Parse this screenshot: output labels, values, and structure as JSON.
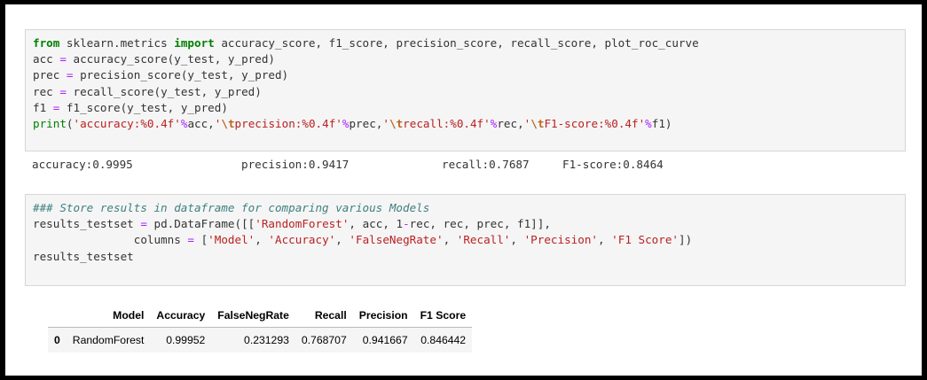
{
  "cell1": {
    "l1": {
      "kw1": "from",
      "mod": " sklearn.metrics ",
      "kw2": "import",
      "rest": " accuracy_score, f1_score, precision_score, recall_score, plot_roc_curve"
    },
    "l2": {
      "a": "acc ",
      "eq": "=",
      "b": " accuracy_score(y_test, y_pred)"
    },
    "l3": {
      "a": "prec ",
      "eq": "=",
      "b": " precision_score(y_test, y_pred)"
    },
    "l4": {
      "a": "rec ",
      "eq": "=",
      "b": " recall_score(y_test, y_pred)"
    },
    "l5": {
      "a": "f1 ",
      "eq": "=",
      "b": " f1_score(y_test, y_pred)"
    },
    "l6": {
      "fn": "print",
      "p1": "(",
      "s1": "'accuracy:%0.4f'",
      "o1": "%",
      "v1": "acc,",
      "s2a": "'",
      "e2": "\\t",
      "s2b": "precision:%0.4f'",
      "o2": "%",
      "v2": "prec,",
      "s3a": "'",
      "e3": "\\t",
      "s3b": "recall:%0.4f'",
      "o3": "%",
      "v3": "rec,",
      "s4a": "'",
      "e4": "\\t",
      "s4b": "F1-score:%0.4f'",
      "o4": "%",
      "v4": "f1)"
    }
  },
  "output1": {
    "accuracy": "accuracy:0.9995",
    "precision": "precision:0.9417",
    "recall": "recall:0.7687",
    "f1": "F1-score:0.8464"
  },
  "cell2": {
    "comment": "### Store results in dataframe for comparing various Models",
    "l2a": "results_testset ",
    "l2eq": "=",
    "l2b": " pd.DataFrame([[",
    "l2s": "'RandomForest'",
    "l2c": ", acc, 1",
    "l2m": "-",
    "l2d": "rec, rec, prec, f1]],",
    "l3a": "               columns ",
    "l3eq": "=",
    "l3b": " [",
    "c1": "'Model'",
    "c2": "'Accuracy'",
    "c3": "'FalseNegRate'",
    "c4": "'Recall'",
    "c5": "'Precision'",
    "c6": "'F1 Score'",
    "sep": ", ",
    "l3end": "])",
    "l4": "results_testset"
  },
  "dataframe": {
    "columns": [
      "Model",
      "Accuracy",
      "FalseNegRate",
      "Recall",
      "Precision",
      "F1 Score"
    ],
    "rows": [
      {
        "index": "0",
        "values": [
          "RandomForest",
          "0.99952",
          "0.231293",
          "0.768707",
          "0.941667",
          "0.846442"
        ]
      }
    ]
  }
}
